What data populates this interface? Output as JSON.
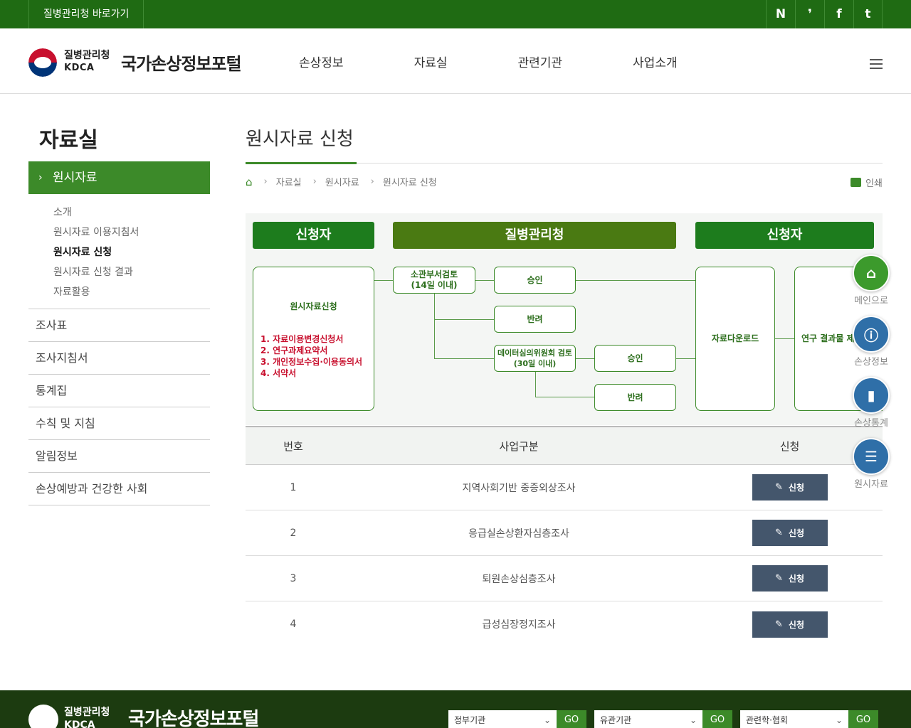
{
  "topbar": {
    "shortcut": "질병관리청 바로가기",
    "sns": [
      "N",
      "❜",
      "f",
      "t"
    ]
  },
  "header": {
    "org_ko": "질병관리청",
    "org_en": "KDCA",
    "site_title": "국가손상정보포털",
    "gnb": [
      "손상정보",
      "자료실",
      "관련기관",
      "사업소개"
    ]
  },
  "sidebar": {
    "title": "자료실",
    "active": "원시자료",
    "sub": [
      "소개",
      "원시자료 이용지침서",
      "원시자료 신청",
      "원시자료 신청 결과",
      "자료활용"
    ],
    "sub_active_index": 2,
    "menu": [
      "조사표",
      "조사지침서",
      "통계집",
      "수칙 및 지침",
      "알림정보",
      "손상예방과 건강한 사회"
    ]
  },
  "content": {
    "title": "원시자료 신청",
    "breadcrumb": [
      "자료실",
      "원시자료",
      "원시자료 신청"
    ],
    "print": "인쇄"
  },
  "diagram": {
    "h1": "신청자",
    "h2": "질병관리청",
    "h3": "신청자",
    "request_title": "원시자료신청",
    "request_list": [
      "1. 자료이용변경신청서",
      "2. 연구과제요약서",
      "3. 개인정보수집·이용동의서",
      "4. 서약서"
    ],
    "review1": "소관부서검토",
    "review1_sub": "(14일 이내)",
    "approve1": "승인",
    "reject1": "반려",
    "review2": "데이터심의위원회 검토",
    "review2_sub": "(30일 이내)",
    "approve2": "승인",
    "reject2": "반려",
    "download": "자료다운로드",
    "result": "연구 결과물 제"
  },
  "table": {
    "headers": [
      "번호",
      "사업구분",
      "신청"
    ],
    "rows": [
      {
        "no": "1",
        "name": "지역사회기반 중증외상조사",
        "btn": "신청"
      },
      {
        "no": "2",
        "name": "응급실손상환자심층조사",
        "btn": "신청"
      },
      {
        "no": "3",
        "name": "퇴원손상심층조사",
        "btn": "신청"
      },
      {
        "no": "4",
        "name": "급성심장정지조사",
        "btn": "신청"
      }
    ]
  },
  "quick": [
    {
      "label": "메인으로",
      "icon": "home-icon",
      "color": "#3c9a2c"
    },
    {
      "label": "손상정보",
      "icon": "alert-icon",
      "color": "#2f6fa8"
    },
    {
      "label": "손상통계",
      "icon": "bar-chart-icon",
      "color": "#2f6fa8"
    },
    {
      "label": "원시자료",
      "icon": "document-icon",
      "color": "#2f6fa8"
    }
  ],
  "footer": {
    "org_ko": "질병관리청",
    "org_en": "KDCA",
    "site_title": "국가손상정보포털",
    "selects": [
      "정부기관",
      "유관기관",
      "관련학·협회"
    ],
    "go": "GO"
  }
}
